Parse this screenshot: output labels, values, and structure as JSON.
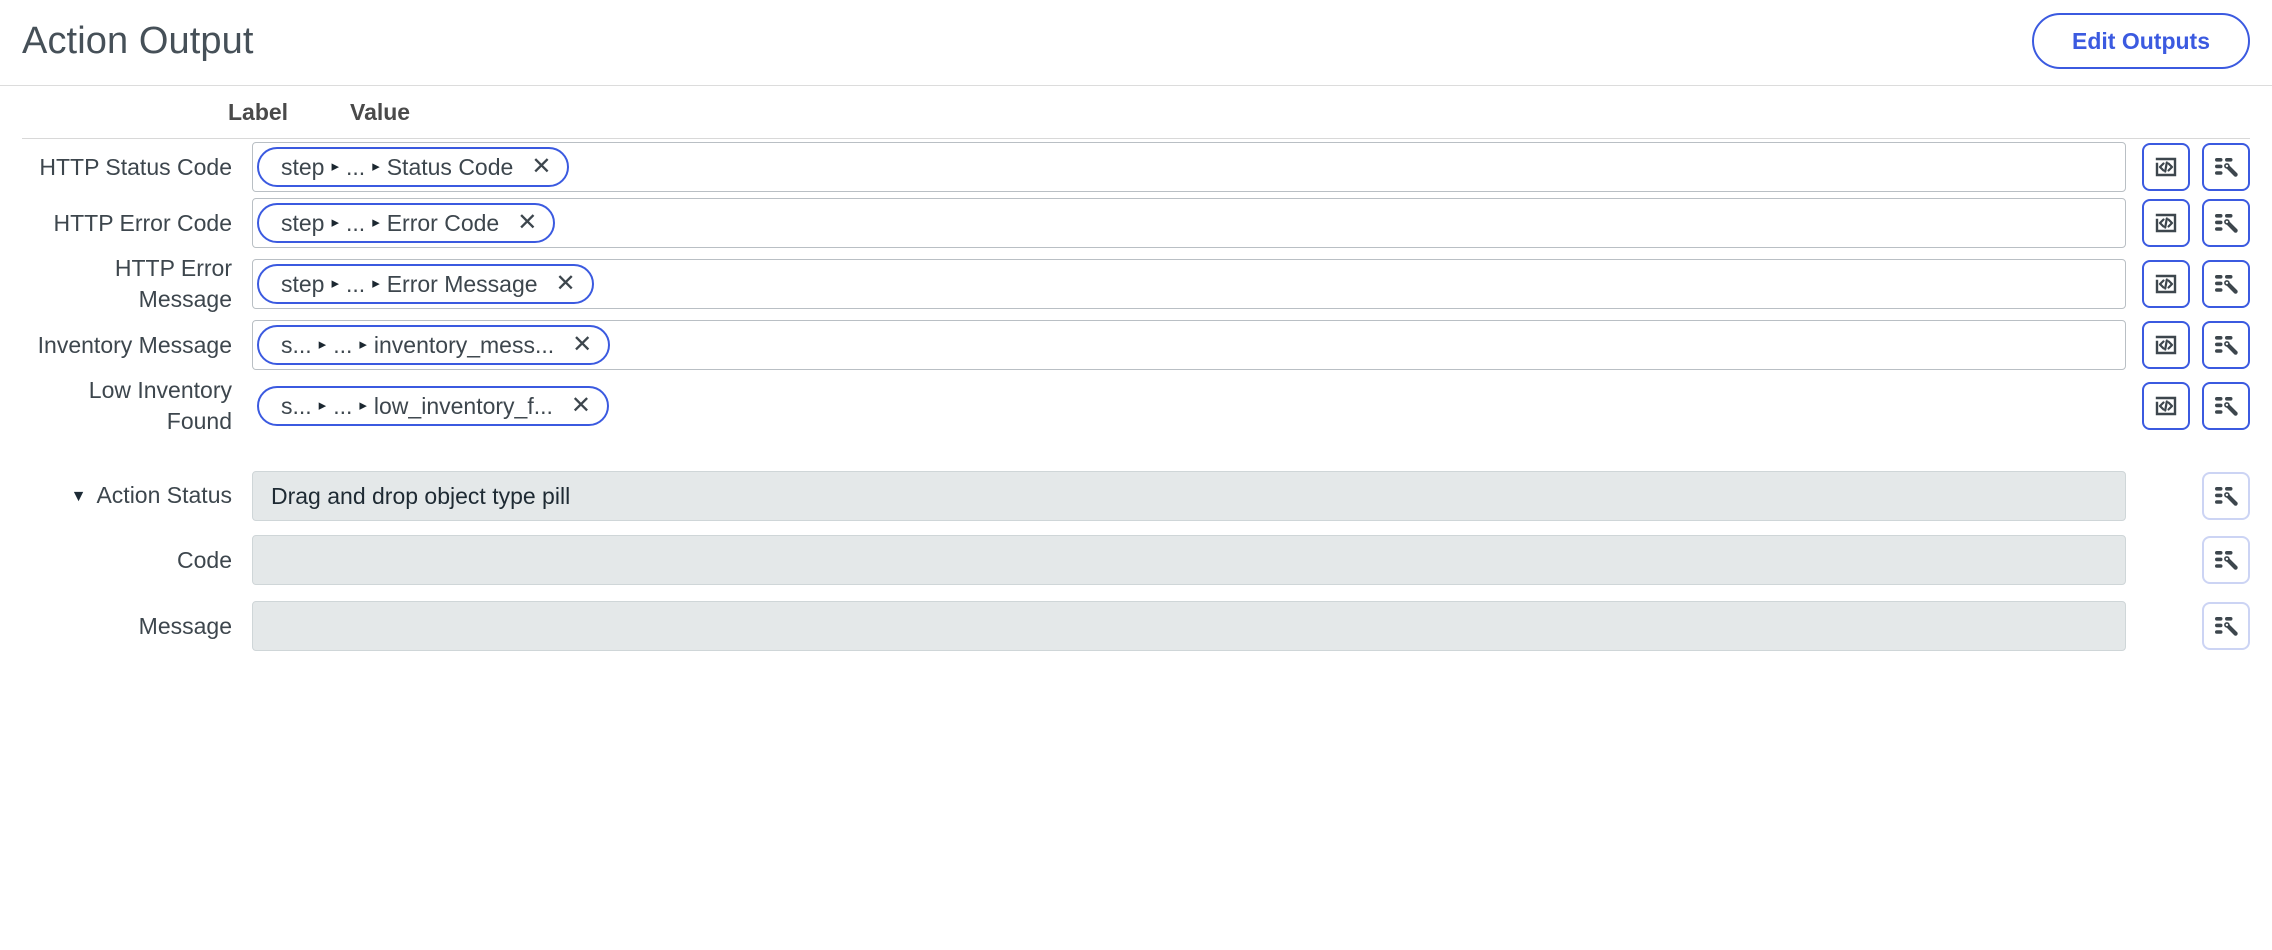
{
  "header": {
    "title": "Action Output",
    "edit_outputs_label": "Edit Outputs"
  },
  "table": {
    "columns": {
      "label": "Label",
      "value": "Value"
    }
  },
  "rows": [
    {
      "label": "HTTP Status Code",
      "pill": {
        "first": "step",
        "middle": "...",
        "last": "Status Code",
        "remove": "✕"
      },
      "has_input_box": true,
      "buttons": [
        "code-icon",
        "wand-list-icon"
      ],
      "buttons_enabled": true
    },
    {
      "label": "HTTP Error Code",
      "pill": {
        "first": "step",
        "middle": "...",
        "last": "Error Code",
        "remove": "✕"
      },
      "has_input_box": true,
      "buttons": [
        "code-icon",
        "wand-list-icon"
      ],
      "buttons_enabled": true
    },
    {
      "label": "HTTP Error Message",
      "pill": {
        "first": "step",
        "middle": "...",
        "last": "Error Message",
        "remove": "✕"
      },
      "has_input_box": true,
      "buttons": [
        "code-icon",
        "wand-list-icon"
      ],
      "buttons_enabled": true
    },
    {
      "label": "Inventory Message",
      "pill": {
        "first": "s...",
        "middle": "...",
        "last": "inventory_mess...",
        "remove": "✕"
      },
      "has_input_box": true,
      "buttons": [
        "code-icon",
        "wand-list-icon"
      ],
      "buttons_enabled": true
    },
    {
      "label": "Low Inventory Found",
      "pill": {
        "first": "s...",
        "middle": "...",
        "last": "low_inventory_f...",
        "remove": "✕"
      },
      "has_input_box": false,
      "buttons": [
        "code-icon",
        "wand-list-icon"
      ],
      "buttons_enabled": true
    }
  ],
  "action_status": {
    "label": "Action Status",
    "caret": "▼",
    "placeholder_text": "Drag and drop object type pill",
    "buttons": [
      "wand-list-icon"
    ]
  },
  "sub_rows": [
    {
      "label": "Code",
      "value": "",
      "buttons": [
        "wand-list-icon"
      ]
    },
    {
      "label": "Message",
      "value": "",
      "buttons": [
        "wand-list-icon"
      ]
    }
  ],
  "colors": {
    "accent_blue": "#3b5ae0",
    "muted_blue": "#ccd4f4",
    "text_dark": "#3d464d",
    "disabled_bg": "#e4e8e9",
    "border_gray": "#b9bfc4"
  },
  "arrow_glyph": "▸"
}
